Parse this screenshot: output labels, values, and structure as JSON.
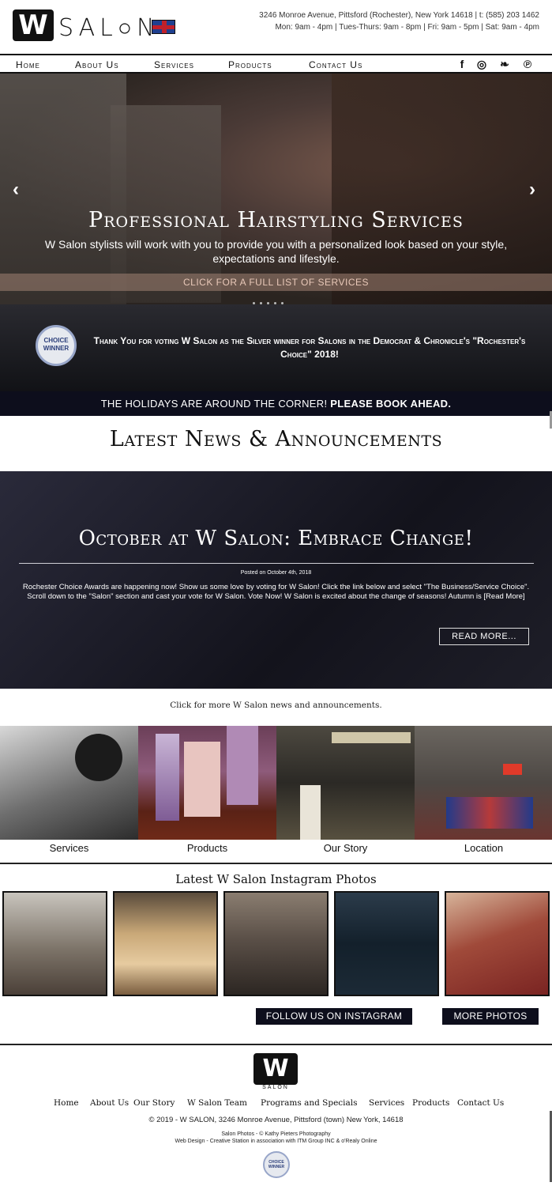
{
  "header": {
    "logo_letter": "W",
    "logo_word": "SAL○N",
    "address": "3246 Monroe Avenue, Pittsford (Rochester), New York 14618 | t: (585) 203 1462",
    "hours": "Mon: 9am - 4pm | Tues-Thurs: 9am - 8pm | Fri: 9am - 5pm | Sat: 9am - 4pm"
  },
  "nav": {
    "items": [
      "Home",
      "About Us",
      "Services",
      "Products",
      "Contact Us"
    ],
    "social": [
      "facebook-icon",
      "instagram-icon",
      "twitter-icon",
      "pinterest-icon"
    ],
    "social_glyphs": [
      "f",
      "◎",
      "❧",
      "℗"
    ]
  },
  "hero": {
    "title": "Professional Hairstyling Services",
    "subtitle": "W Salon stylists will work with you to provide you with a personalized look based on your style, expectations and lifestyle.",
    "cta": "CLICK FOR A FULL LIST OF SERVICES",
    "prev": "‹",
    "next": "›"
  },
  "award": {
    "badge_text": "CHOICE WINNER",
    "text": "Thank You for voting W Salon as the Silver winner for Salons in the Democrat & Chronicle's \"Rochester's Choice\" 2018!"
  },
  "holiday": {
    "text": "THE HOLIDAYS ARE AROUND THE CORNER!",
    "bold": "PLEASE BOOK AHEAD."
  },
  "news": {
    "title": "Latest News & Announcements",
    "post_title": "October at W Salon: Embrace Change!",
    "posted": "Posted on October 4th, 2018",
    "excerpt": "Rochester Choice Awards are happening now! Show us some love by voting for W Salon! Click the link below and select \"The Business/Service Choice\". Scroll down to the \"Salon\" section and cast your vote for W Salon. Vote Now! W Salon is excited about the change of seasons! Autumn is  [Read More]",
    "read_more": "READ MORE...",
    "more_link": "Click for more W Salon news and announcements."
  },
  "tiles": [
    "Services",
    "Products",
    "Our Story",
    "Location"
  ],
  "instagram": {
    "title": "Latest W Salon Instagram Photos",
    "follow": "FOLLOW US ON INSTAGRAM",
    "more": "MORE PHOTOS"
  },
  "footer": {
    "logo_letter": "W",
    "logo_label": "SALON",
    "nav": [
      "Home",
      "About Us",
      "Our Story",
      "W Salon Team",
      "Programs and Specials",
      "Services",
      "Products",
      "Contact Us"
    ],
    "copyright": "© 2019 - W SALON, 3246 Monroe Avenue, Pittsford (town) New York, 14618",
    "photos_credit": "Salon Photos - © Kathy Pieters Photography",
    "design_credit": "Web Design - Creative Station in association with ITM Group INC & o'Realy Online",
    "badge_text": "CHOICE WINNER"
  }
}
